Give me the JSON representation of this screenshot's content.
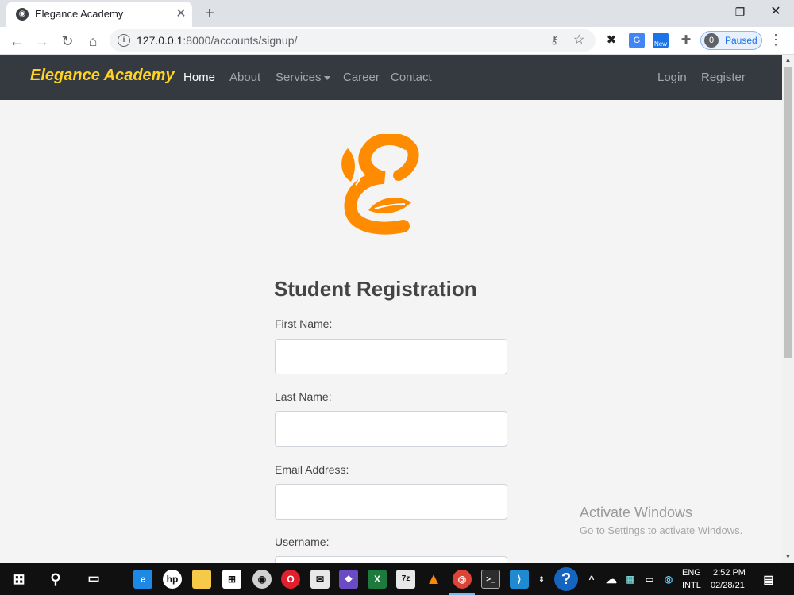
{
  "browser": {
    "tab_title": "Elegance Academy",
    "tab_close": "✕",
    "new_tab": "+",
    "url_host": "127.0.0.1",
    "url_path": ":8000/accounts/signup/",
    "profile_initial": "0",
    "profile_status": "Paused",
    "ext_new_label": "New"
  },
  "site": {
    "brand": "Elegance Academy",
    "nav": [
      "Home",
      "About",
      "Services",
      "Career",
      "Contact"
    ],
    "nav_right": [
      "Login",
      "Register"
    ]
  },
  "form": {
    "title": "Student Registration",
    "fields": [
      {
        "label": "First Name:",
        "value": ""
      },
      {
        "label": "Last Name:",
        "value": ""
      },
      {
        "label": "Email Address:",
        "value": ""
      },
      {
        "label": "Username:",
        "value": ""
      }
    ]
  },
  "watermark": {
    "line1": "Activate Windows",
    "line2": "Go to Settings to activate Windows."
  },
  "taskbar": {
    "lang1": "ENG",
    "lang2": "INTL",
    "time": "2:52 PM",
    "date": "02/28/21"
  },
  "colors": {
    "brand": "#ffd320",
    "logo_orange": "#ff8c00",
    "navbar_bg": "#343a40"
  }
}
